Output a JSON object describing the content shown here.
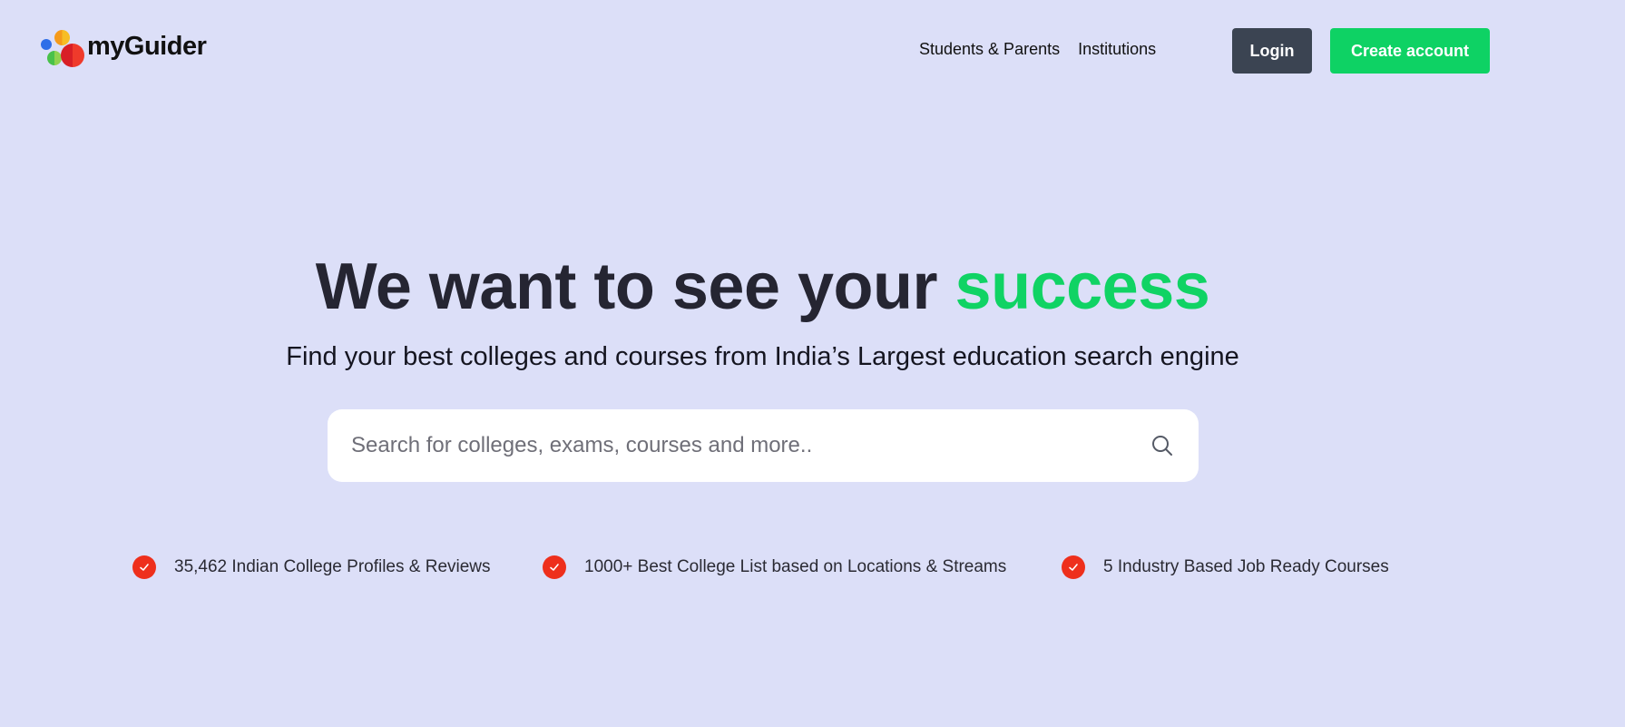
{
  "brand": {
    "name": "myGuider",
    "colors": {
      "background": "#dcdff8",
      "accent_green": "#10d364",
      "login_bg": "#3b4452",
      "check_red": "#ee2f1c"
    }
  },
  "nav": {
    "items": [
      {
        "label": "Students & Parents"
      },
      {
        "label": "Institutions"
      }
    ]
  },
  "auth": {
    "login_label": "Login",
    "create_label": "Create account"
  },
  "hero": {
    "title_main": "We want to see your ",
    "title_accent": "success",
    "subtitle": "Find your best colleges and courses from India’s Largest education search engine"
  },
  "search": {
    "placeholder": "Search for colleges, exams, courses and more..",
    "value": "",
    "icon": "search-icon"
  },
  "features": [
    {
      "text": "35,462 Indian College Profiles & Reviews",
      "icon": "check-icon"
    },
    {
      "text": "1000+ Best College List based on Locations & Streams",
      "icon": "check-icon"
    },
    {
      "text": "5 Industry Based Job Ready Courses",
      "icon": "check-icon"
    }
  ]
}
